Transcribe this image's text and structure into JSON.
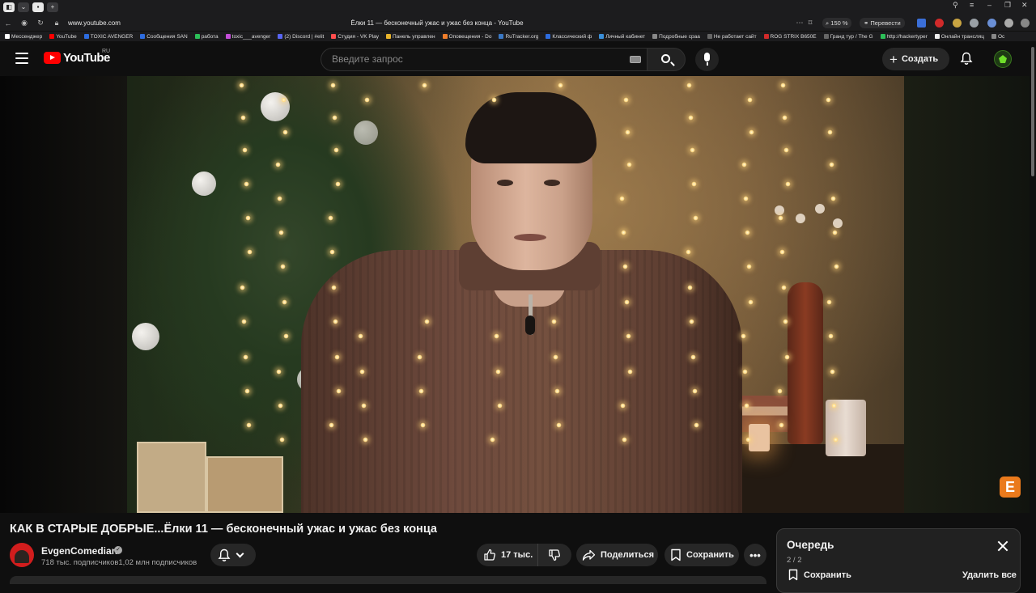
{
  "browser": {
    "url": "www.youtube.com",
    "tab_title": "Ёлки 11 — бесконечный ужас и ужас без конца - YouTube",
    "zoom": "150 %",
    "translate_label": "Перевести"
  },
  "bookmarks": [
    {
      "label": "Мессенджер",
      "color": "#ffffff"
    },
    {
      "label": "YouTube",
      "color": "#ff0000"
    },
    {
      "label": "TOXIC AVENGER",
      "color": "#2d6cdf"
    },
    {
      "label": "Сообщения SAN",
      "color": "#2d6cdf"
    },
    {
      "label": "работа",
      "color": "#2cbf58"
    },
    {
      "label": "toxic___avenger",
      "color": "#c44dd9"
    },
    {
      "label": "(2) Discord | #elit",
      "color": "#5865f2"
    },
    {
      "label": "Студия - VK Play",
      "color": "#ff4d4d"
    },
    {
      "label": "Панель управлен",
      "color": "#e8b42c"
    },
    {
      "label": "Оповещения - Do",
      "color": "#ef7d2a"
    },
    {
      "label": "RuTracker.org",
      "color": "#3a78c4"
    },
    {
      "label": "Классический ф",
      "color": "#2d6cdf"
    },
    {
      "label": "Личный кабинет",
      "color": "#3a8fd9"
    },
    {
      "label": "Подробные сраа",
      "color": "#888888"
    },
    {
      "label": "Не работает сайт",
      "color": "#666666"
    },
    {
      "label": "ROG STRIX B650E",
      "color": "#d12a2a"
    },
    {
      "label": "Гранд тур / The G",
      "color": "#666666"
    },
    {
      "label": "http://hackertyper",
      "color": "#2cbf58"
    },
    {
      "label": "Онлайн трансляц",
      "color": "#eeeeee"
    },
    {
      "label": "Ос",
      "color": "#888888"
    }
  ],
  "youtube": {
    "logo_text": "YouTube",
    "country_code": "RU",
    "search_placeholder": "Введите запрос",
    "create_label": "Создать"
  },
  "video": {
    "title": "КАК В СТАРЫЕ ДОБРЫЕ...Ёлки 11 — бесконечный ужас и ужас без конца",
    "channel_name": "EvgenComedian",
    "subscribers": "718 тыс. подписчиков1,02 млн подписчиков",
    "likes": "17 тыс.",
    "share_label": "Поделиться",
    "save_label": "Сохранить",
    "channel_logo_letter": "E"
  },
  "queue": {
    "title": "Очередь",
    "count": "2 / 2",
    "save_label": "Сохранить",
    "clear_label": "Удалить все"
  },
  "colors": {
    "accent": "#ff0000",
    "background": "#0f0f0f",
    "pill": "#272727"
  }
}
